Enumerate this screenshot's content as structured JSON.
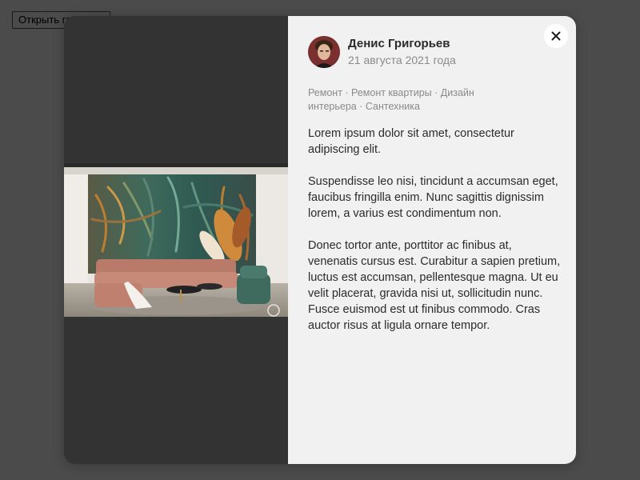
{
  "page": {
    "open_button_label": "Открыть галерею"
  },
  "post": {
    "author_name": "Денис Григорьев",
    "date": "21 августа 2021 года",
    "tags": [
      {
        "label": "Ремонт"
      },
      {
        "label": "Ремонт квартиры"
      },
      {
        "label": "Дизайн интерьера"
      },
      {
        "label": "Сантехника"
      }
    ],
    "tag_separator": " · ",
    "paragraphs": [
      "Lorem ipsum dolor sit amet, consectetur adipiscing elit.",
      "Suspendisse leo nisi, tincidunt a accumsan eget, faucibus fringilla enim. Nunc sagittis dignissim lorem, a varius est condimentum non.",
      "Donec tortor ante, porttitor ac finibus at, venenatis cursus est. Curabitur a sapien pretium, luctus est accumsan, pellentesque magna. Ut eu velit placerat, gravida nisi ut, sollicitudin nunc. Fusce euismod est ut finibus commodo. Cras auctor risus at ligula ornare tempor."
    ]
  },
  "icons": {
    "close": "close-icon"
  },
  "colors": {
    "overlay": "#4b4b4b",
    "media_background": "#333333",
    "panel_background": "#f1f1f1",
    "text_primary": "#2b2b2b",
    "text_secondary": "#8a8a8a"
  }
}
